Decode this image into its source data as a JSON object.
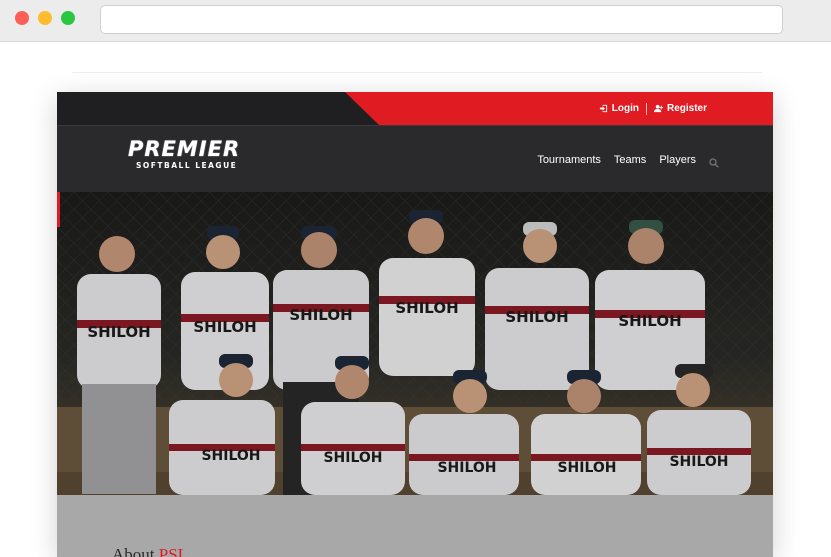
{
  "browser": {
    "url": ""
  },
  "topbar": {
    "login_label": "Login",
    "register_label": "Register",
    "login_icon": "sign-in-icon",
    "register_icon": "user-plus-icon"
  },
  "logo": {
    "main": "PREMIER",
    "sub": "SOFTBALL LEAGUE"
  },
  "nav": {
    "items": [
      {
        "label": "Tournaments"
      },
      {
        "label": "Teams"
      },
      {
        "label": "Players"
      }
    ],
    "search_icon": "search-icon"
  },
  "hero": {
    "jersey_text": "SHILOH",
    "description": "team photo"
  },
  "about": {
    "prefix": "About",
    "accent": "PSL"
  },
  "colors": {
    "accent": "#e01c22",
    "dark": "#1f1f21",
    "navbar": "#2a2a2c"
  }
}
